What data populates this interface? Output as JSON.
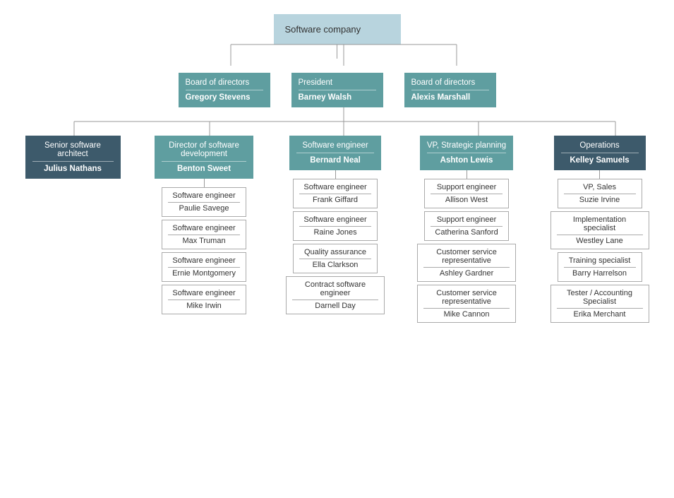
{
  "chart": {
    "root": {
      "role": "Software company",
      "name": ""
    },
    "level2": [
      {
        "role": "Board of directors",
        "name": "Gregory Stevens",
        "style": "teal"
      },
      {
        "role": "President",
        "name": "Barney Walsh",
        "style": "teal"
      },
      {
        "role": "Board of directors",
        "name": "Alexis Marshall",
        "style": "teal"
      }
    ],
    "level3": [
      {
        "role": "Senior software architect",
        "name": "Julius Nathans",
        "style": "dark"
      },
      {
        "role": "Director of software development",
        "name": "Benton Sweet",
        "style": "teal"
      },
      {
        "role": "Software engineer",
        "name": "Bernard Neal",
        "style": "teal"
      },
      {
        "role": "VP, Strategic planning",
        "name": "Ashton Lewis",
        "style": "teal"
      },
      {
        "role": "Operations",
        "name": "Kelley Samuels",
        "style": "dark"
      }
    ],
    "level4": [
      {
        "parent_index": 0,
        "leaves": []
      },
      {
        "parent_index": 1,
        "leaves": [
          {
            "role": "Software engineer",
            "name": "Paulie Savege"
          },
          {
            "role": "Software engineer",
            "name": "Max Truman"
          },
          {
            "role": "Software engineer",
            "name": "Ernie Montgomery"
          },
          {
            "role": "Software engineer",
            "name": "Mike Irwin"
          }
        ]
      },
      {
        "parent_index": 2,
        "leaves": [
          {
            "role": "Software engineer",
            "name": "Frank Giffard"
          },
          {
            "role": "Software engineer",
            "name": "Raine Jones"
          },
          {
            "role": "Quality assurance",
            "name": "Ella Clarkson"
          },
          {
            "role": "Contract software engineer",
            "name": "Darnell Day"
          }
        ]
      },
      {
        "parent_index": 3,
        "leaves": [
          {
            "role": "Support engineer",
            "name": "Allison West"
          },
          {
            "role": "Support engineer",
            "name": "Catherina Sanford"
          },
          {
            "role": "Customer service representative",
            "name": "Ashley Gardner"
          },
          {
            "role": "Customer service representative",
            "name": "Mike Cannon"
          }
        ]
      },
      {
        "parent_index": 4,
        "leaves": [
          {
            "role": "VP, Sales",
            "name": "Suzie Irvine"
          },
          {
            "role": "Implementation specialist",
            "name": "Westley Lane"
          },
          {
            "role": "Training specialist",
            "name": "Barry Harrelson"
          },
          {
            "role": "Tester / Accounting Specialist",
            "name": "Erika Merchant"
          }
        ]
      }
    ]
  }
}
